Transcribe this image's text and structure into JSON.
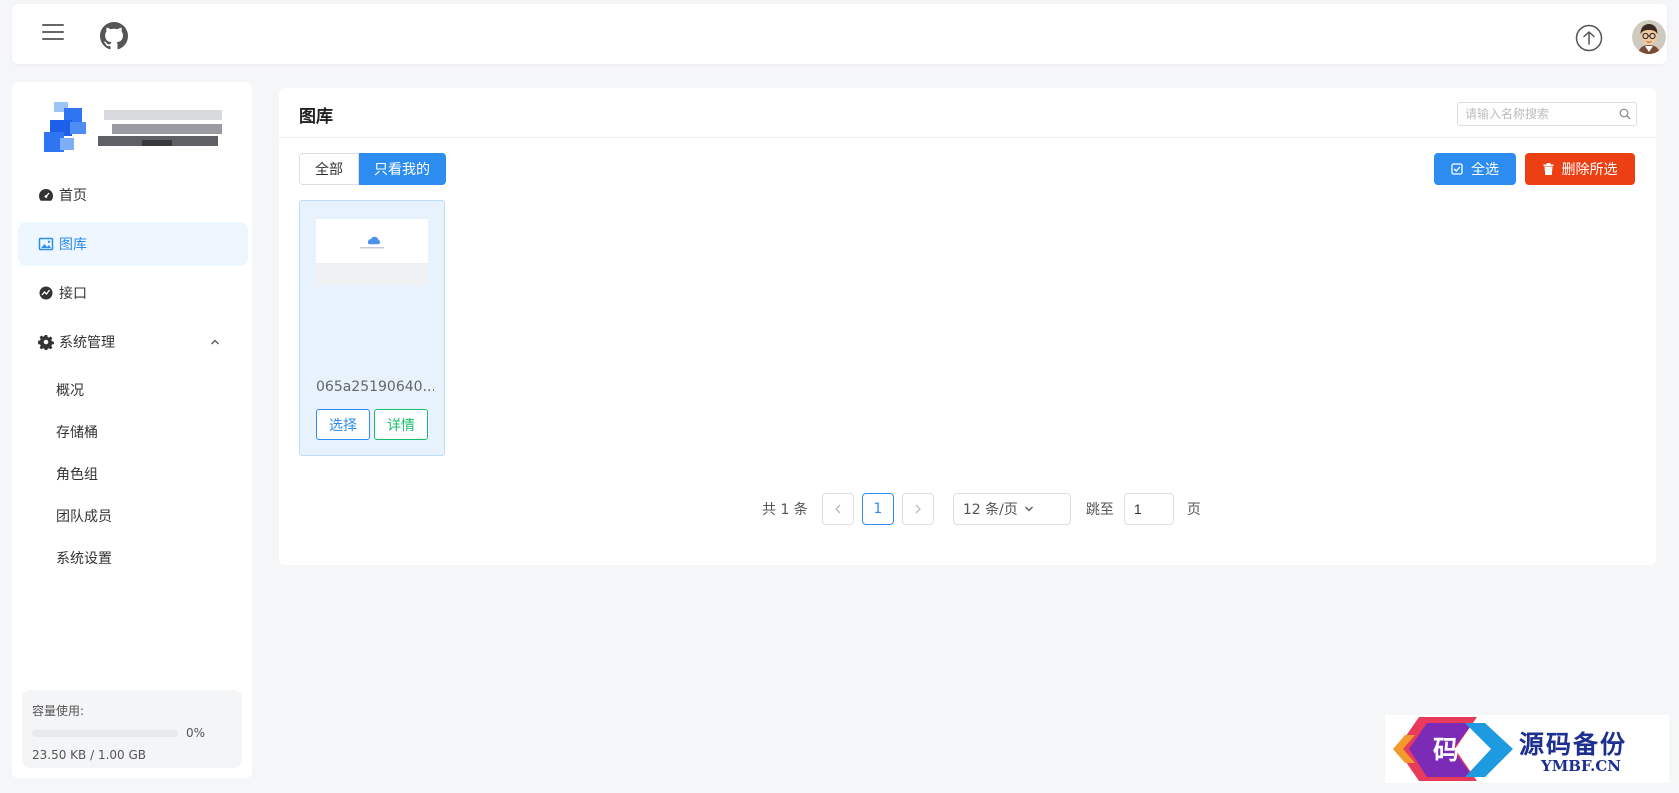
{
  "sidebar": {
    "items": [
      {
        "label": "首页"
      },
      {
        "label": "图库"
      },
      {
        "label": "接口"
      },
      {
        "label": "系统管理"
      }
    ],
    "sub_items": [
      {
        "label": "概况"
      },
      {
        "label": "存储桶"
      },
      {
        "label": "角色组"
      },
      {
        "label": "团队成员"
      },
      {
        "label": "系统设置"
      }
    ],
    "storage": {
      "label": "容量使用:",
      "percent_label": "0%",
      "used_fraction": 0,
      "size_text": "23.50 KB / 1.00 GB"
    }
  },
  "main": {
    "title": "图库",
    "search_placeholder": "请输入名称搜索",
    "tabs": [
      {
        "label": "全部"
      },
      {
        "label": "只看我的"
      }
    ],
    "select_all_label": "全选",
    "delete_selected_label": "删除所选",
    "images": [
      {
        "name": "065a25190640...",
        "select_label": "选择",
        "detail_label": "详情"
      }
    ]
  },
  "pagination": {
    "total_text": "共 1 条",
    "current_page": "1",
    "page_size_text": "12 条/页",
    "jump_label": "跳至",
    "jump_value": "1",
    "page_unit": "页"
  },
  "watermark": {
    "glyph": "码",
    "cn_text": "源码备份",
    "en_text": "YMBF.CN"
  },
  "colors": {
    "primary": "#2d8cf0",
    "danger": "#ed3f14",
    "success": "#19be6b"
  }
}
